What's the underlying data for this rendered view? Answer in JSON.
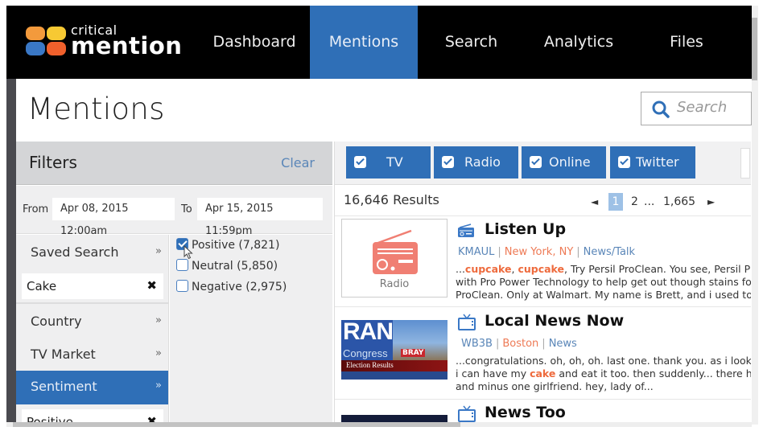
{
  "brand": {
    "line1": "critical",
    "line2": "mention",
    "colors": [
      "#f39a3c",
      "#f7c933",
      "#3a78c6",
      "#f0602c"
    ]
  },
  "nav": {
    "items": [
      {
        "label": "Dashboard",
        "active": false
      },
      {
        "label": "Mentions",
        "active": true
      },
      {
        "label": "Search",
        "active": false
      },
      {
        "label": "Analytics",
        "active": false
      },
      {
        "label": "Files",
        "active": false
      }
    ]
  },
  "page": {
    "title": "Mentions"
  },
  "search": {
    "placeholder": "Search"
  },
  "filters": {
    "title": "Filters",
    "clear_label": "Clear",
    "from_label": "From",
    "from_value": "Apr 08, 2015 12:00am",
    "to_label": "To",
    "to_value": "Apr 15, 2015 11:59pm",
    "facets": [
      {
        "label": "Saved Search",
        "arrow": "»"
      },
      {
        "label": "Country",
        "arrow": "»"
      },
      {
        "label": "TV Market",
        "arrow": "»"
      },
      {
        "label": "Sentiment",
        "arrow": "»",
        "active": true
      }
    ],
    "chips": [
      {
        "label": "Cake",
        "remove": "✖"
      },
      {
        "label": "Positive",
        "remove": "✖"
      }
    ],
    "sentiments": [
      {
        "label": "Positive (7,821)",
        "checked": true
      },
      {
        "label": "Neutral (5,850)",
        "checked": false
      },
      {
        "label": "Negative (2,975)",
        "checked": false
      }
    ]
  },
  "media_tabs": [
    {
      "label": "TV",
      "checked": true
    },
    {
      "label": "Radio",
      "checked": true
    },
    {
      "label": "Online",
      "checked": true
    },
    {
      "label": "Twitter",
      "checked": true
    }
  ],
  "results": {
    "count_label": "16,646 Results",
    "pager": {
      "prev": "◄",
      "current": "1",
      "next_page": "2",
      "ellipsis": "...",
      "last": "1,665",
      "next": "►"
    },
    "items": [
      {
        "type": "radio",
        "thumb_caption": "Radio",
        "title": "Listen Up",
        "station": "KMAUL",
        "market": "New York, NY",
        "genre": "News/Talk",
        "snippet_lines": [
          {
            "pre": "...",
            "hl1": "cupcake",
            "mid": ", ",
            "hl2": "cupcake",
            "post": ", Try Persil ProClean. You see, Persil Pro"
          },
          {
            "text": "with Pro Power Technology to help get out though stains fo"
          },
          {
            "text": "ProClean. Only at Walmart. My name is Brett, and i used to"
          }
        ]
      },
      {
        "type": "tv",
        "thumb_caption": "Election Results",
        "thumb_text_big": "RAN",
        "thumb_text_small": "Congress",
        "thumb_sign": "BRAY",
        "title": "Local News Now",
        "station": "WB3B",
        "market": "Boston",
        "genre": "News",
        "snippet_lines": [
          {
            "text": "...congratulations. oh, oh, oh. last one. thank you. as i looke"
          },
          {
            "pre": "i can have my ",
            "hl1": "cake",
            "post": " and eat it too. then suddenly... there he"
          },
          {
            "text": "and minus one girlfriend. hey, lady of..."
          }
        ]
      },
      {
        "type": "tv",
        "title": "News Too"
      }
    ]
  }
}
